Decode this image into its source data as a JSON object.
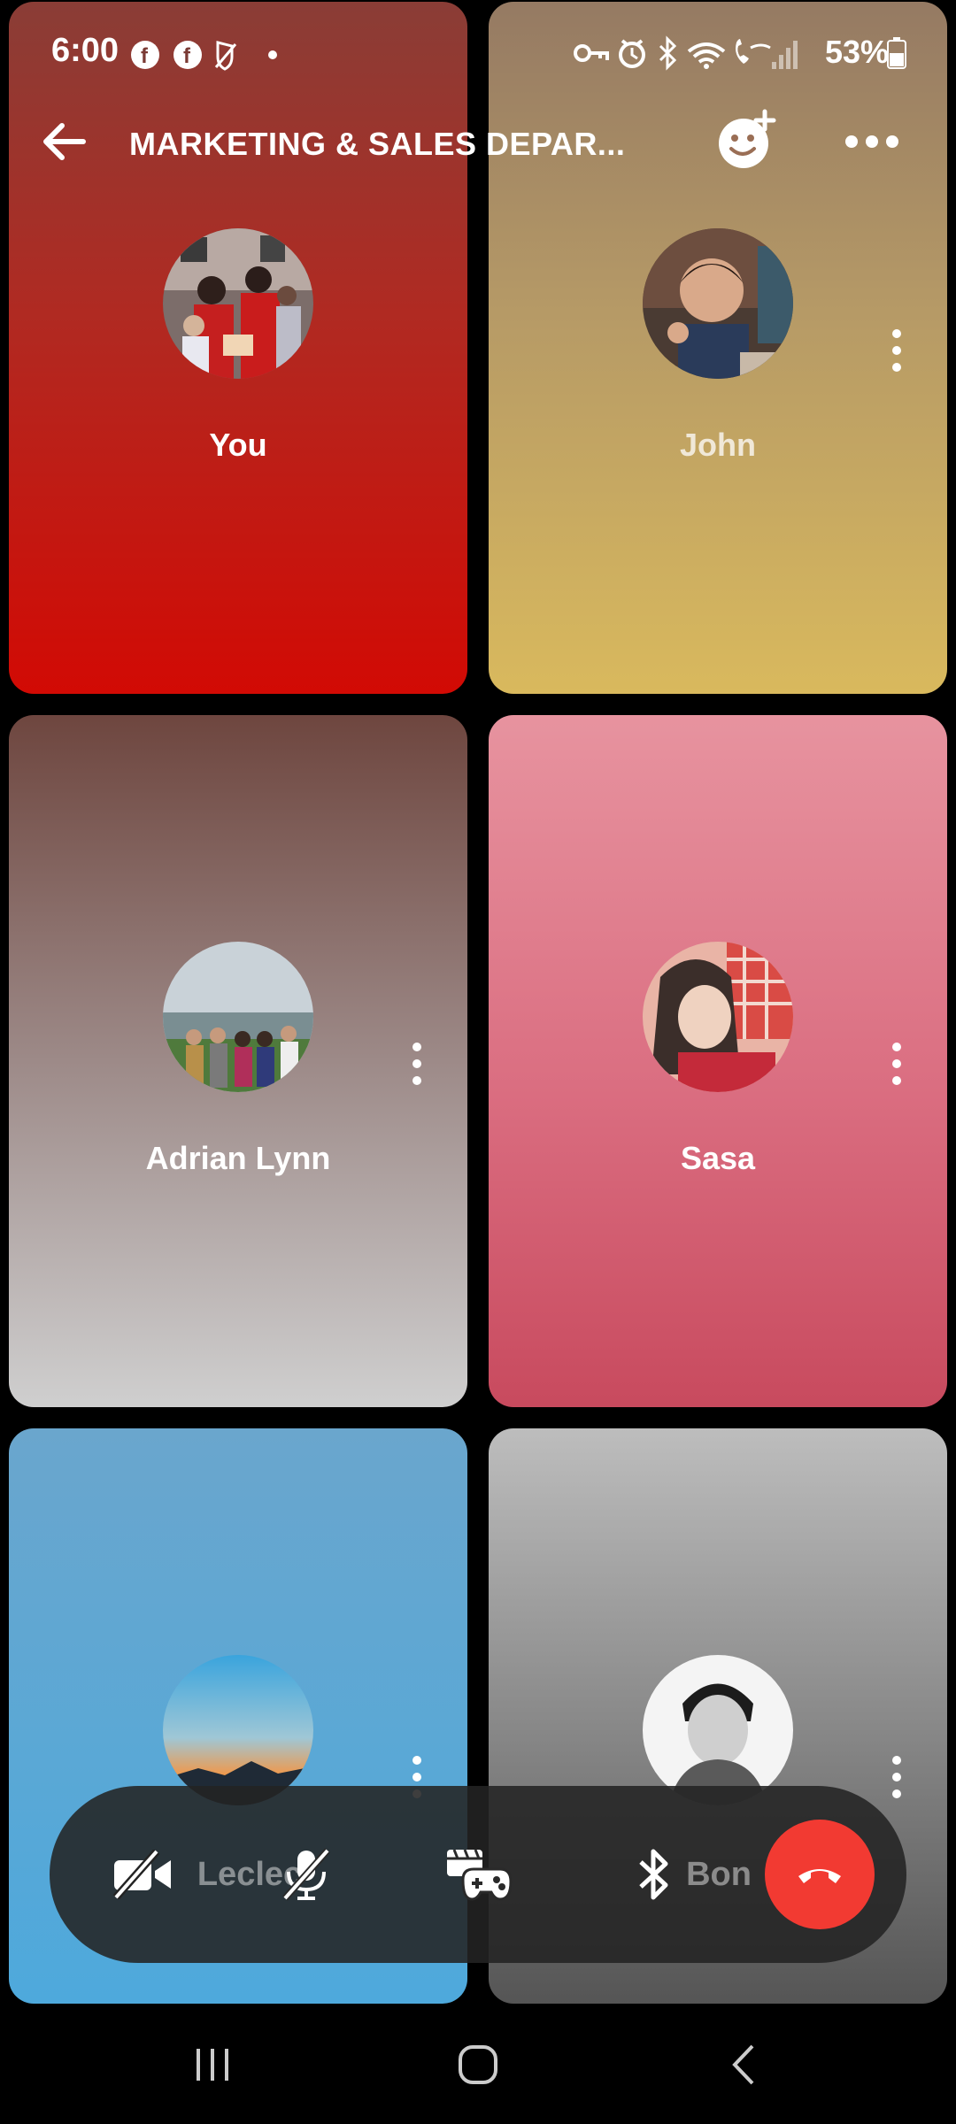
{
  "status_bar": {
    "time": "6:00",
    "battery": "53%"
  },
  "header": {
    "title": "MARKETING & SALES DEPAR..."
  },
  "participants": [
    {
      "name": "You"
    },
    {
      "name": "John"
    },
    {
      "name": "Adrian Lynn"
    },
    {
      "name": "Sasa"
    },
    {
      "name": "Leclec"
    },
    {
      "name": "Bon"
    }
  ],
  "controls": {
    "left_name": "Leclec",
    "right_name": "Bon"
  },
  "icons": [
    "back-arrow-icon",
    "add-people-icon",
    "more-options-icon",
    "video-off-icon",
    "mic-off-icon",
    "games-icon",
    "bluetooth-icon",
    "end-call-icon"
  ],
  "colors": {
    "end_call": "#f23a32",
    "controls_bg": "#232323"
  }
}
